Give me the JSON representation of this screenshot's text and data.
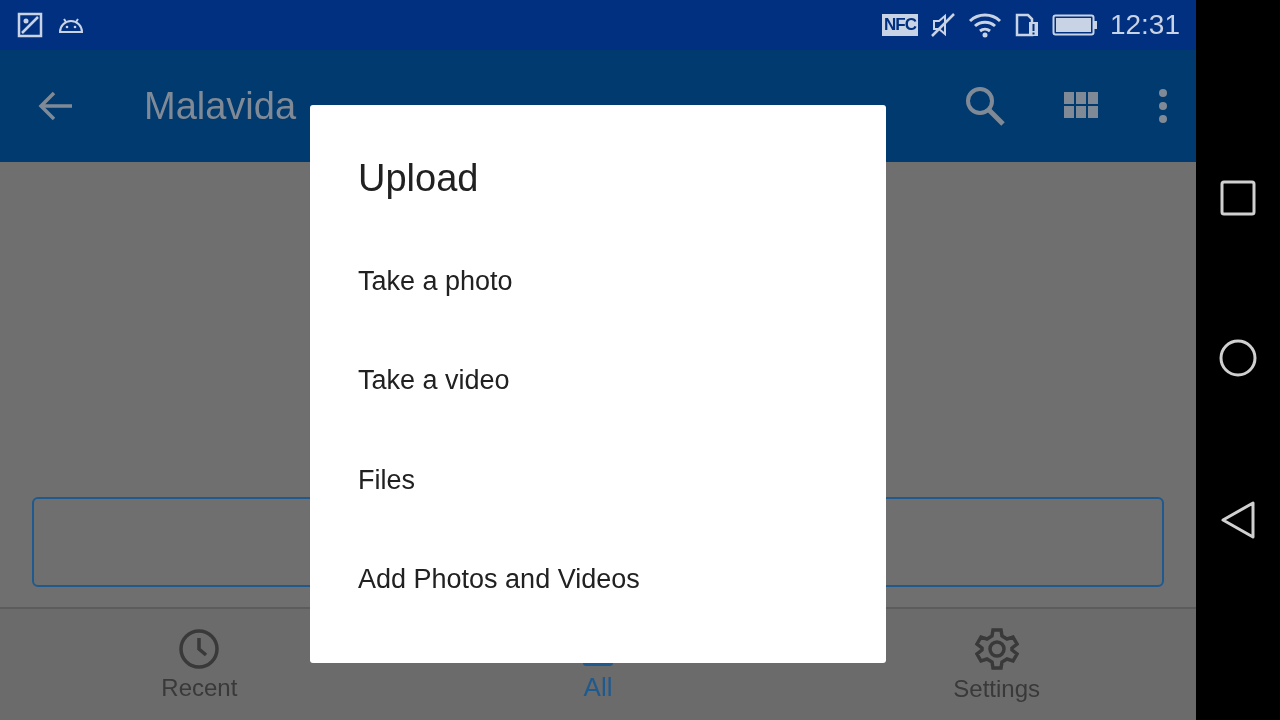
{
  "status_bar": {
    "time": "12:31",
    "nfc": "NFC"
  },
  "app_bar": {
    "title": "Malavida"
  },
  "bottom_nav": [
    {
      "label": "Recent",
      "kind": "recent",
      "selected": false
    },
    {
      "label": "All",
      "kind": "all",
      "selected": true
    },
    {
      "label": "Settings",
      "kind": "settings",
      "selected": false
    }
  ],
  "dialog": {
    "title": "Upload",
    "items": [
      "Take a photo",
      "Take a video",
      "Files",
      "Add Photos and Videos"
    ]
  }
}
